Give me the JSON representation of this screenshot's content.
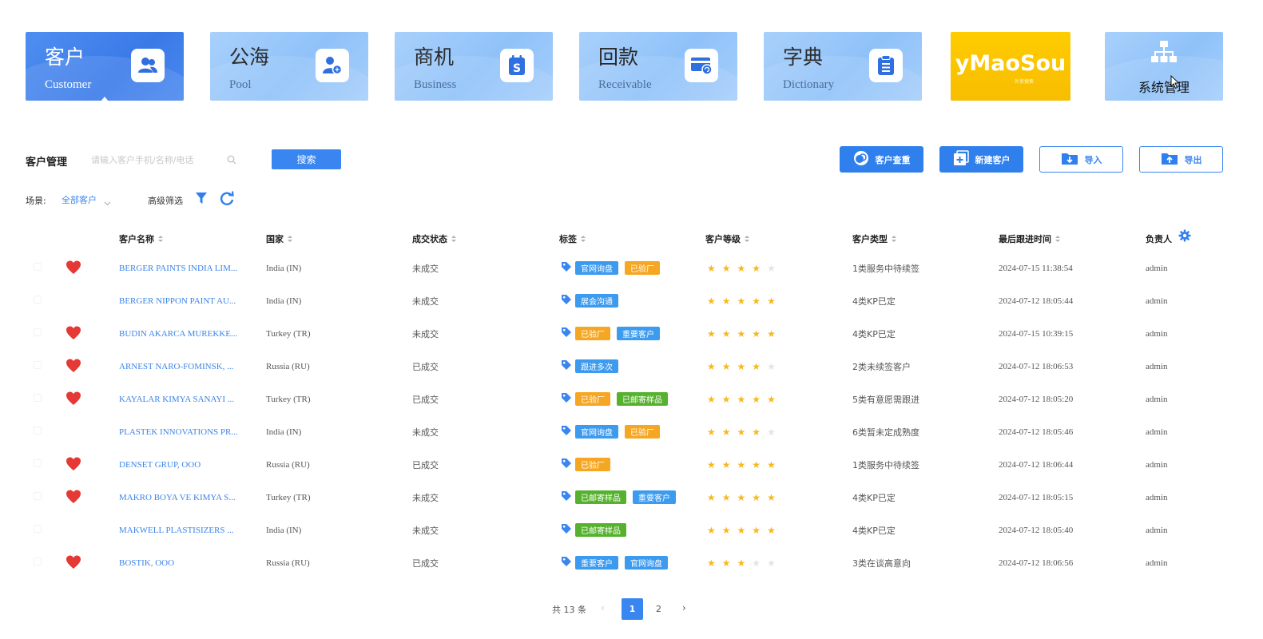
{
  "modules": [
    {
      "cn": "客户",
      "en": "Customer",
      "icon": "customers-icon",
      "active": true
    },
    {
      "cn": "公海",
      "en": "Pool",
      "icon": "pool-user-icon",
      "active": false
    },
    {
      "cn": "商机",
      "en": "Business",
      "icon": "business-s-icon",
      "active": false
    },
    {
      "cn": "回款",
      "en": "Receivable",
      "icon": "card-payment-icon",
      "active": false
    },
    {
      "cn": "字典",
      "en": "Dictionary",
      "icon": "clipboard-list-icon",
      "active": false
    }
  ],
  "brand": {
    "name": "yMaoSou",
    "sub": "外贸搜索"
  },
  "system": {
    "label": "系统管理",
    "icon": "org-chart-icon"
  },
  "toolbar": {
    "title": "客户管理",
    "search_placeholder": "请输入客户手机/名称/电话",
    "search_label": "搜索",
    "check_label": "客户查重",
    "new_label": "新建客户",
    "import_label": "导入",
    "export_label": "导出"
  },
  "scene": {
    "label": "场景:",
    "value": "全部客户",
    "advanced": "高级筛选"
  },
  "columns": {
    "name": "客户名称",
    "country": "国家",
    "status": "成交状态",
    "tags": "标签",
    "level": "客户等级",
    "type": "客户类型",
    "last_follow": "最后跟进时间",
    "owner": "负责人"
  },
  "rows": [
    {
      "fav": true,
      "name": "BERGER PAINTS INDIA LIM...",
      "country": "India (IN)",
      "status": "未成交",
      "tags": [
        {
          "t": "官网询盘",
          "c": "blue"
        },
        {
          "t": "已验厂",
          "c": "orange"
        }
      ],
      "stars": 4,
      "type": "1类服务中待续签",
      "time": "2024-07-15 11:38:54",
      "owner": "admin"
    },
    {
      "fav": false,
      "name": "BERGER NIPPON PAINT AU...",
      "country": "India (IN)",
      "status": "未成交",
      "tags": [
        {
          "t": "展会沟通",
          "c": "blue"
        }
      ],
      "stars": 5,
      "type": "4类KP已定",
      "time": "2024-07-12 18:05:44",
      "owner": "admin"
    },
    {
      "fav": true,
      "name": "BUDIN AKARCA MUREKKE...",
      "country": "Turkey (TR)",
      "status": "未成交",
      "tags": [
        {
          "t": "已验厂",
          "c": "orange"
        },
        {
          "t": "重要客户",
          "c": "blue"
        }
      ],
      "stars": 5,
      "type": "4类KP已定",
      "time": "2024-07-15 10:39:15",
      "owner": "admin"
    },
    {
      "fav": true,
      "name": "ARNEST NARO-FOMINSK, ...",
      "country": "Russia (RU)",
      "status": "已成交",
      "tags": [
        {
          "t": "跟进多次",
          "c": "blue"
        }
      ],
      "stars": 4,
      "type": "2类未续签客户",
      "time": "2024-07-12 18:06:53",
      "owner": "admin"
    },
    {
      "fav": true,
      "name": "KAYALAR KIMYA SANAYI ...",
      "country": "Turkey (TR)",
      "status": "已成交",
      "tags": [
        {
          "t": "已验厂",
          "c": "orange"
        },
        {
          "t": "已邮寄样品",
          "c": "green"
        }
      ],
      "stars": 5,
      "type": "5类有意愿需跟进",
      "time": "2024-07-12 18:05:20",
      "owner": "admin"
    },
    {
      "fav": false,
      "name": "PLASTEK INNOVATIONS PR...",
      "country": "India (IN)",
      "status": "未成交",
      "tags": [
        {
          "t": "官网询盘",
          "c": "blue"
        },
        {
          "t": "已验厂",
          "c": "orange"
        }
      ],
      "stars": 4,
      "type": "6类暂未定成熟度",
      "time": "2024-07-12 18:05:46",
      "owner": "admin"
    },
    {
      "fav": true,
      "name": "DENSET GRUP, OOO",
      "country": "Russia (RU)",
      "status": "已成交",
      "tags": [
        {
          "t": "已验厂",
          "c": "orange"
        }
      ],
      "stars": 5,
      "type": "1类服务中待续签",
      "time": "2024-07-12 18:06:44",
      "owner": "admin"
    },
    {
      "fav": true,
      "name": "MAKRO BOYA VE KIMYA S...",
      "country": "Turkey (TR)",
      "status": "未成交",
      "tags": [
        {
          "t": "已邮寄样品",
          "c": "green"
        },
        {
          "t": "重要客户",
          "c": "blue"
        }
      ],
      "stars": 5,
      "type": "4类KP已定",
      "time": "2024-07-12 18:05:15",
      "owner": "admin"
    },
    {
      "fav": false,
      "name": "MAKWELL PLASTISIZERS ...",
      "country": "India (IN)",
      "status": "未成交",
      "tags": [
        {
          "t": "已邮寄样品",
          "c": "green"
        }
      ],
      "stars": 5,
      "type": "4类KP已定",
      "time": "2024-07-12 18:05:40",
      "owner": "admin"
    },
    {
      "fav": true,
      "name": "BOSTIK, OOO",
      "country": "Russia (RU)",
      "status": "已成交",
      "tags": [
        {
          "t": "重要客户",
          "c": "blue"
        },
        {
          "t": "官网询盘",
          "c": "blue"
        }
      ],
      "stars": 3,
      "type": "3类在谈高意向",
      "time": "2024-07-12 18:06:56",
      "owner": "admin"
    }
  ],
  "pagination": {
    "total": "共 13 条",
    "pages": [
      "1",
      "2"
    ],
    "current": "1"
  },
  "colors": {
    "accent": "#3a86f0",
    "tag_blue": "#3c9aef",
    "tag_orange": "#f5a623",
    "tag_green": "#56b22e",
    "star": "#f8b81c",
    "heart": "#e53935",
    "brand": "#ffcc00"
  }
}
